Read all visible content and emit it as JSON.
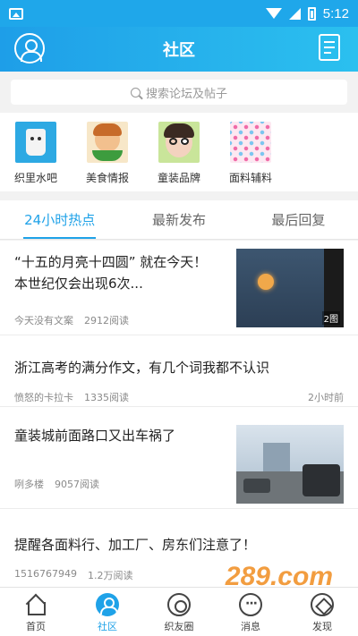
{
  "status_bar": {
    "time": "5:12"
  },
  "header": {
    "title": "社区"
  },
  "search": {
    "placeholder": "搜索论坛及帖子"
  },
  "categories": [
    {
      "label": "织里水吧",
      "icon": "water-bar-icon"
    },
    {
      "label": "美食情报",
      "icon": "food-info-icon"
    },
    {
      "label": "童装品牌",
      "icon": "kids-brand-icon"
    },
    {
      "label": "面料辅料",
      "icon": "fabric-icon"
    }
  ],
  "tabs": [
    {
      "label": "24小时热点",
      "active": true
    },
    {
      "label": "最新发布",
      "active": false
    },
    {
      "label": "最后回复",
      "active": false
    }
  ],
  "posts": [
    {
      "title_line1": "“十五的月亮十四圆” 就在今天！",
      "title_line2": "本世纪仅会出现6次...",
      "author": "今天没有文案",
      "reads": "2912阅读",
      "image_badge": "2图"
    },
    {
      "title_line1": "浙江高考的满分作文，有几个词我都不认识",
      "author": "愤怒的卡拉卡",
      "reads": "1335阅读",
      "time": "2小时前"
    },
    {
      "title_line1": "童装城前面路口又出车祸了",
      "author": "咧多楼",
      "reads": "9057阅读"
    },
    {
      "title_line1": "提醒各面料行、加工厂、房东们注意了！",
      "author": "1516767949",
      "reads": "1.2万阅读"
    }
  ],
  "bottom_nav": [
    {
      "label": "首页",
      "active": false
    },
    {
      "label": "社区",
      "active": true
    },
    {
      "label": "织友圈",
      "active": false
    },
    {
      "label": "消息",
      "active": false
    },
    {
      "label": "发现",
      "active": false
    }
  ],
  "watermark": "289.com",
  "colors": {
    "accent": "#1fa2e8",
    "header_start": "#1e9ee8",
    "header_end": "#2bc0ef"
  }
}
